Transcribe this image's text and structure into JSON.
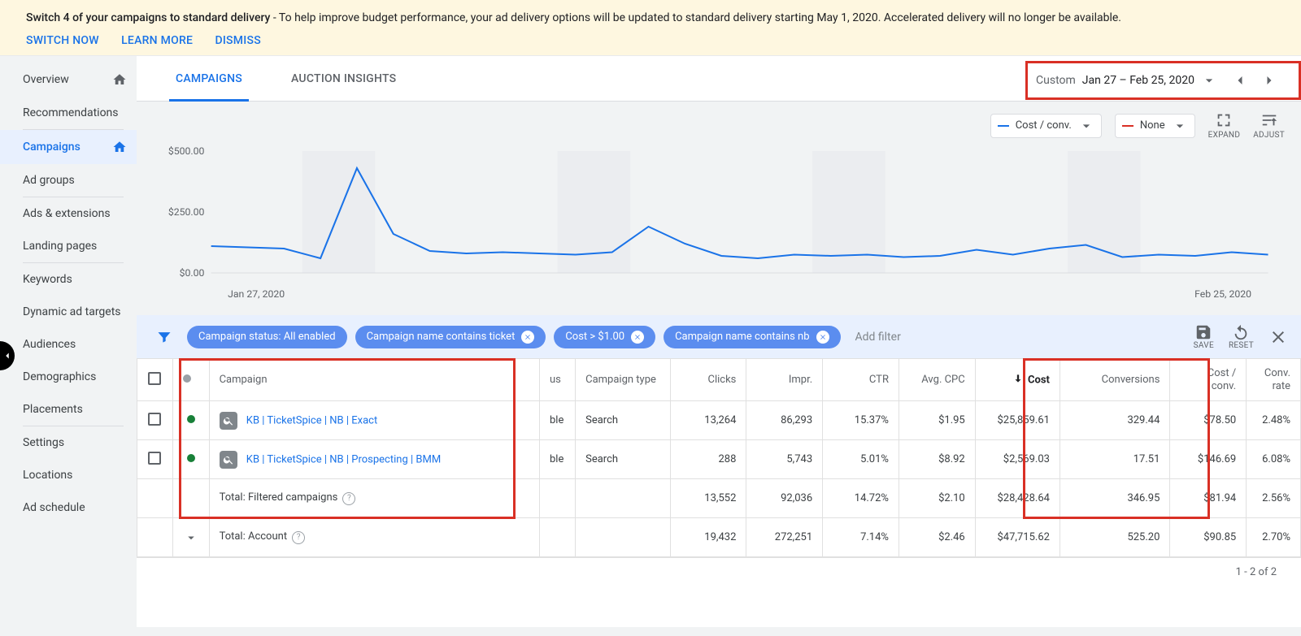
{
  "banner": {
    "bold": "Switch 4 of your campaigns to standard delivery",
    "rest": " - To help improve budget performance, your ad delivery options will be updated to standard delivery starting May 1, 2020. Accelerated delivery will no longer be available.",
    "switch_now": "SWITCH NOW",
    "learn_more": "LEARN MORE",
    "dismiss": "DISMISS"
  },
  "sidebar": {
    "items": [
      {
        "label": "Overview",
        "home": true
      },
      {
        "label": "Recommendations"
      },
      {
        "label": "Campaigns",
        "home": true,
        "active": true
      },
      {
        "label": "Ad groups"
      },
      {
        "label": "Ads & extensions"
      },
      {
        "label": "Landing pages"
      },
      {
        "label": "Keywords"
      },
      {
        "label": "Dynamic ad targets"
      },
      {
        "label": "Audiences"
      },
      {
        "label": "Demographics"
      },
      {
        "label": "Placements"
      },
      {
        "label": "Settings"
      },
      {
        "label": "Locations"
      },
      {
        "label": "Ad schedule"
      }
    ]
  },
  "tabs": {
    "campaigns": "CAMPAIGNS",
    "auction": "AUCTION INSIGHTS"
  },
  "date_picker": {
    "label": "Custom",
    "range": "Jan 27 – Feb 25, 2020"
  },
  "chart_controls": {
    "metric1": "Cost / conv.",
    "metric2": "None",
    "expand": "EXPAND",
    "adjust": "ADJUST"
  },
  "chart_data": {
    "type": "line",
    "ylabel": "",
    "ylim": [
      0,
      500
    ],
    "y_ticks": [
      "$500.00",
      "$250.00",
      "$0.00"
    ],
    "x_start": "Jan 27, 2020",
    "x_end": "Feb 25, 2020",
    "series": [
      {
        "name": "Cost / conv.",
        "color": "#1a73e8",
        "values": [
          110,
          105,
          100,
          60,
          430,
          160,
          90,
          80,
          85,
          80,
          75,
          85,
          190,
          120,
          70,
          60,
          75,
          70,
          75,
          65,
          70,
          95,
          75,
          100,
          115,
          65,
          75,
          70,
          85,
          75
        ]
      }
    ]
  },
  "filters": {
    "chips": [
      {
        "label": "Campaign status: All enabled",
        "removable": false
      },
      {
        "label": "Campaign name contains ticket",
        "removable": true
      },
      {
        "label": "Cost > $1.00",
        "removable": true
      },
      {
        "label": "Campaign name contains nb",
        "removable": true
      }
    ],
    "add_filter": "Add filter",
    "save": "SAVE",
    "reset": "RESET"
  },
  "table": {
    "headers": {
      "campaign": "Campaign",
      "status_cut": "us",
      "type": "Campaign type",
      "clicks": "Clicks",
      "impr": "Impr.",
      "ctr": "CTR",
      "avg_cpc": "Avg. CPC",
      "cost": "Cost",
      "conversions": "Conversions",
      "cost_conv_l1": "Cost /",
      "cost_conv_l2": "conv.",
      "conv_rate_l1": "Conv.",
      "conv_rate_l2": "rate"
    },
    "rows": [
      {
        "name": "KB | TicketSpice | NB | Exact",
        "status_cut": "ble",
        "type": "Search",
        "clicks": "13,264",
        "impr": "86,293",
        "ctr": "15.37%",
        "avg_cpc": "$1.95",
        "cost": "$25,859.61",
        "conv": "329.44",
        "cost_conv": "$78.50",
        "conv_rate": "2.48%"
      },
      {
        "name": "KB | TicketSpice | NB | Prospecting | BMM",
        "status_cut": "ble",
        "type": "Search",
        "clicks": "288",
        "impr": "5,743",
        "ctr": "5.01%",
        "avg_cpc": "$8.92",
        "cost": "$2,569.03",
        "conv": "17.51",
        "cost_conv": "$146.69",
        "conv_rate": "6.08%"
      }
    ],
    "totals": {
      "filtered": {
        "label": "Total: Filtered campaigns",
        "clicks": "13,552",
        "impr": "92,036",
        "ctr": "14.72%",
        "avg_cpc": "$2.10",
        "cost": "$28,428.64",
        "conv": "346.95",
        "cost_conv": "$81.94",
        "conv_rate": "2.56%"
      },
      "account": {
        "label": "Total: Account",
        "clicks": "19,432",
        "impr": "272,251",
        "ctr": "7.14%",
        "avg_cpc": "$2.46",
        "cost": "$47,715.62",
        "conv": "525.20",
        "cost_conv": "$90.85",
        "conv_rate": "2.70%"
      }
    }
  },
  "pagination": "1 - 2 of 2"
}
